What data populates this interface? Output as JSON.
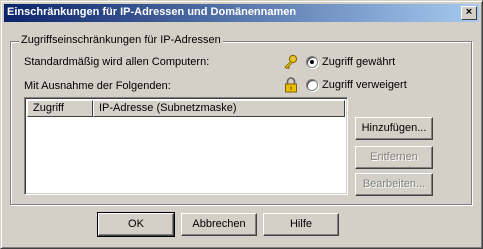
{
  "window": {
    "title": "Einschränkungen für IP-Adressen und Domänennamen",
    "close_glyph": "×"
  },
  "group": {
    "title": "Zugriffseinschränkungen für IP-Adressen",
    "default_label": "Standardmäßig wird allen Computern:",
    "exception_label": "Mit Ausnahme der Folgenden:",
    "options": [
      {
        "label": "Zugriff gewährt",
        "selected": true,
        "icon": "key-icon"
      },
      {
        "label": "Zugriff verweigert",
        "selected": false,
        "icon": "lock-icon"
      }
    ]
  },
  "list": {
    "columns": [
      "Zugriff",
      "IP-Adresse (Subnetzmaske)"
    ],
    "rows": []
  },
  "side_buttons": {
    "add": "Hinzufügen...",
    "remove": "Entfernen",
    "edit": "Bearbeiten..."
  },
  "footer_buttons": {
    "ok": "OK",
    "cancel": "Abbrechen",
    "help": "Hilfe"
  },
  "colors": {
    "face": "#d4d0c8",
    "title_start": "#0a246a",
    "title_end": "#a6caf0",
    "disabled_text": "#808080"
  }
}
